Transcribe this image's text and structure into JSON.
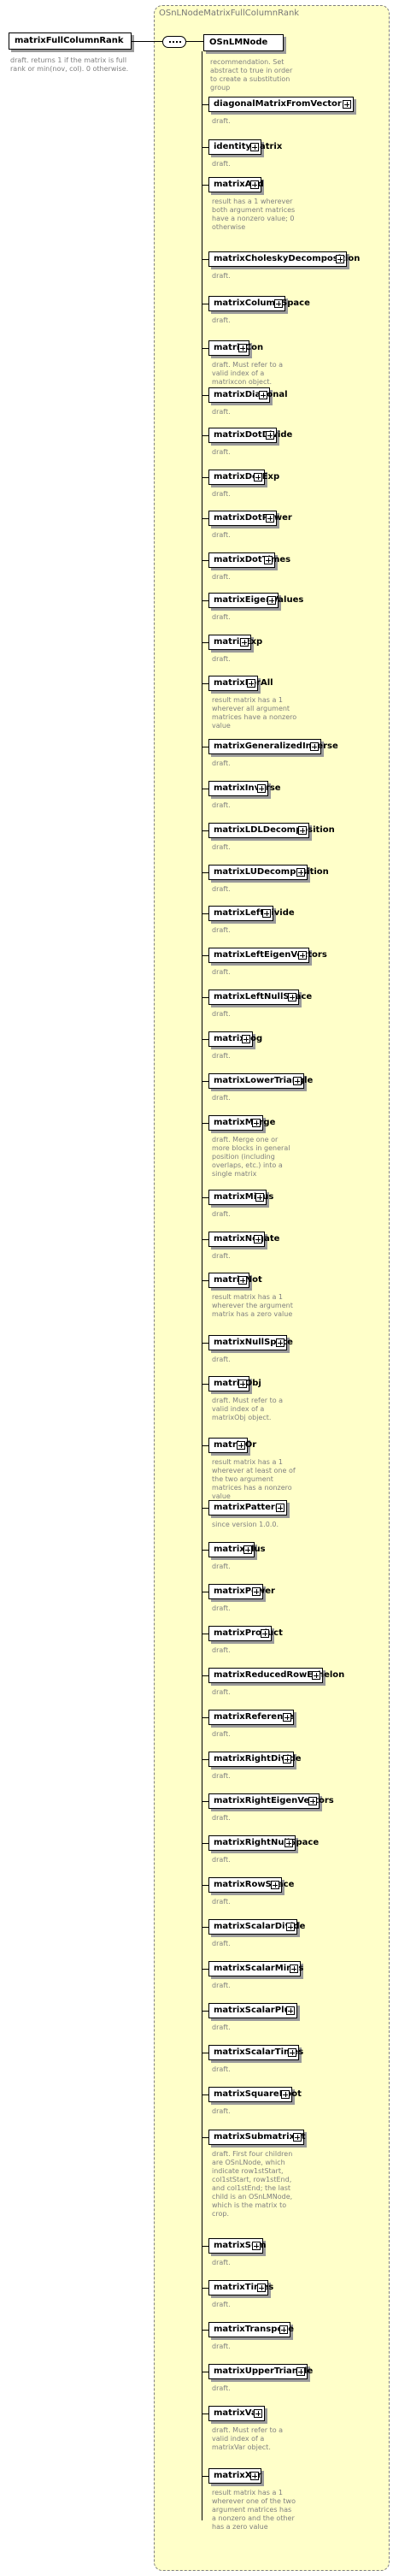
{
  "root": {
    "label": "matrixFullColumnRank",
    "description": "draft. returns 1 if the matrix is full rank or min(nov, col). 0 otherwise."
  },
  "group": {
    "title": "OSnLNodeMatrixFullColumnRank"
  },
  "reference": {
    "label": "OSnLMNode",
    "description": "recommendation. Set abstract to true in order to create a substitution group"
  },
  "items": [
    {
      "label": "diagonalMatrixFromVector",
      "description": "draft."
    },
    {
      "label": "identityMatrix",
      "description": "draft."
    },
    {
      "label": "matrixAnd",
      "description": "result has a 1 wherever both argument matrices have a nonzero value; 0 otherwise"
    },
    {
      "label": "matrixCholeskyDecomposition",
      "description": "draft."
    },
    {
      "label": "matrixColumnSpace",
      "description": "draft."
    },
    {
      "label": "matrixCon",
      "description": "draft. Must refer to a valid index of a matrixcon object."
    },
    {
      "label": "matrixDiagonal",
      "description": "draft."
    },
    {
      "label": "matrixDotDivide",
      "description": "draft."
    },
    {
      "label": "matrixDotExp",
      "description": "draft."
    },
    {
      "label": "matrixDotPower",
      "description": "draft."
    },
    {
      "label": "matrixDotTimes",
      "description": "draft."
    },
    {
      "label": "matrixEigenValues",
      "description": "draft."
    },
    {
      "label": "matrixExp",
      "description": "draft."
    },
    {
      "label": "matrixForAll",
      "description": "result matrix has a 1 wherever all argument matrices have a nonzero value"
    },
    {
      "label": "matrixGeneralizedInverse",
      "description": "draft."
    },
    {
      "label": "matrixInverse",
      "description": "draft."
    },
    {
      "label": "matrixLDLDecomposition",
      "description": "draft."
    },
    {
      "label": "matrixLUDecomposition",
      "description": "draft."
    },
    {
      "label": "matrixLeftDivide",
      "description": "draft."
    },
    {
      "label": "matrixLeftEigenVectors",
      "description": "draft."
    },
    {
      "label": "matrixLeftNullSpace",
      "description": "draft."
    },
    {
      "label": "matrixLog",
      "description": "draft."
    },
    {
      "label": "matrixLowerTriangle",
      "description": "draft."
    },
    {
      "label": "matrixMerge",
      "description": "draft. Merge one or more blocks in general position (including overlaps, etc.) into a single matrix"
    },
    {
      "label": "matrixMinus",
      "description": "draft."
    },
    {
      "label": "matrixNegate",
      "description": "draft."
    },
    {
      "label": "matrixNot",
      "description": "result matrix has a 1 wherever the argument matrix has a zero value"
    },
    {
      "label": "matrixNullSpace",
      "description": "draft."
    },
    {
      "label": "matrixObj",
      "description": "draft. Must refer to a valid index of a matrixObj object."
    },
    {
      "label": "matrixOr",
      "description": "result matrix has a 1 wherever at least one of the two argument matrices has a nonzero value"
    },
    {
      "label": "matrixPattern",
      "description": "since version 1.0.0."
    },
    {
      "label": "matrixPlus",
      "description": "draft."
    },
    {
      "label": "matrixPower",
      "description": "draft."
    },
    {
      "label": "matrixProduct",
      "description": "draft."
    },
    {
      "label": "matrixReducedRowEchelon",
      "description": "draft."
    },
    {
      "label": "matrixReference",
      "description": "draft."
    },
    {
      "label": "matrixRightDivide",
      "description": "draft."
    },
    {
      "label": "matrixRightEigenVectors",
      "description": "draft."
    },
    {
      "label": "matrixRightNullSpace",
      "description": "draft."
    },
    {
      "label": "matrixRowSpace",
      "description": "draft."
    },
    {
      "label": "matrixScalarDivide",
      "description": "draft."
    },
    {
      "label": "matrixScalarMinus",
      "description": "draft."
    },
    {
      "label": "matrixScalarPlus",
      "description": "draft."
    },
    {
      "label": "matrixScalarTimes",
      "description": "draft."
    },
    {
      "label": "matrixSquareRoot",
      "description": "draft."
    },
    {
      "label": "matrixSubmatrixAt",
      "description": "draft. First four children are OSnLNode, which indicate row1stStart, col1stStart, row1stEnd, and col1stEnd; the last child is an OSnLMNode, which is the matrix to crop."
    },
    {
      "label": "matrixSum",
      "description": "draft."
    },
    {
      "label": "matrixTimes",
      "description": "draft."
    },
    {
      "label": "matrixTranspose",
      "description": "draft."
    },
    {
      "label": "matrixUpperTriangle",
      "description": "draft."
    },
    {
      "label": "matrixVar",
      "description": "draft. Must refer to a valid index of a matrixVar object."
    },
    {
      "label": "matrixXor",
      "description": "result matrix has a 1 wherever one of the two argument matrices has a nonzero and the other has a zero value"
    }
  ]
}
